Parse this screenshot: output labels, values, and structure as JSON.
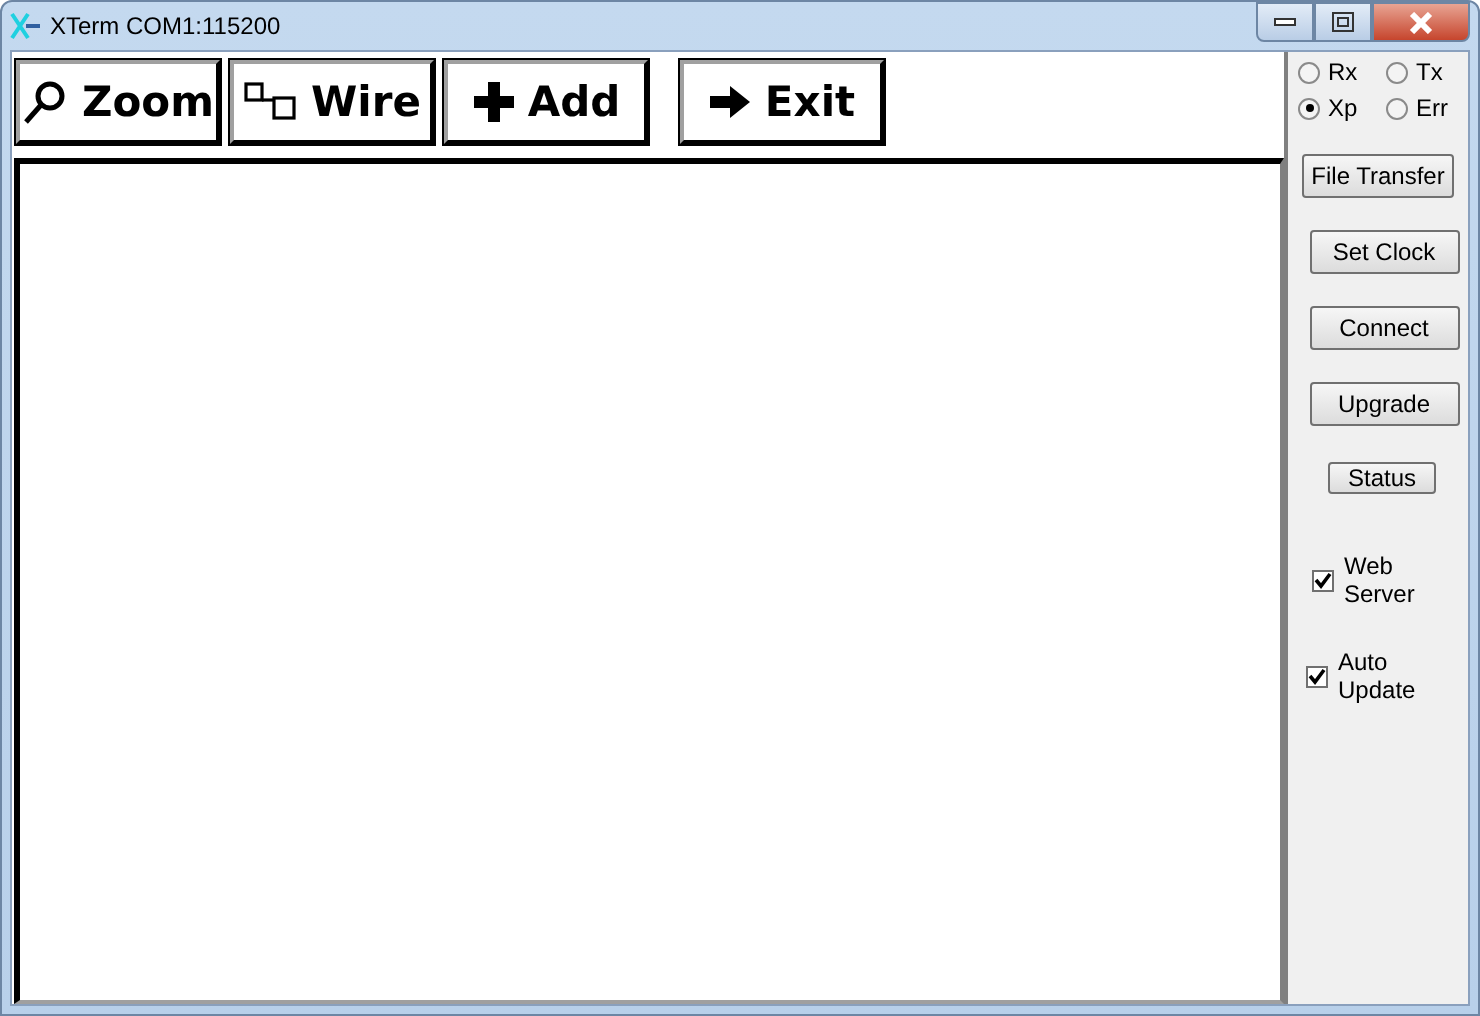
{
  "window": {
    "title": "XTerm COM1:115200"
  },
  "toolbar": [
    {
      "label": "Zoom",
      "kind": "zoom"
    },
    {
      "label": "Wire",
      "kind": "wire"
    },
    {
      "label": "Add",
      "kind": "add"
    },
    {
      "label": "Exit",
      "kind": "exit"
    }
  ],
  "mode_radios": [
    {
      "label": "Rx",
      "selected": false
    },
    {
      "label": "Tx",
      "selected": false
    },
    {
      "label": "Xp",
      "selected": true
    },
    {
      "label": "Err",
      "selected": false
    }
  ],
  "side_buttons": [
    "File Transfer",
    "Set Clock",
    "Connect",
    "Upgrade",
    "Status"
  ],
  "checkboxes": [
    {
      "label": "Web Server",
      "checked": true
    },
    {
      "label": "Auto Update",
      "checked": true
    }
  ]
}
